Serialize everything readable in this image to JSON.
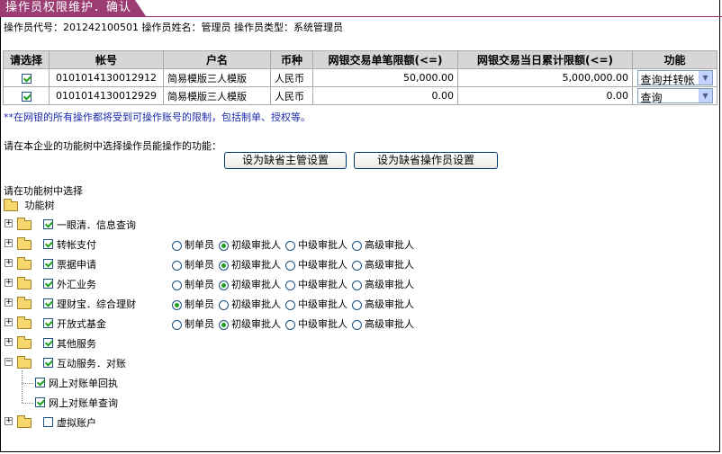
{
  "title_tab": "操作员权限维护．确认",
  "operator_info": "操作员代号：201242100501 操作员姓名：管理员 操作员类型：系统管理员",
  "table": {
    "headers": [
      "请选择",
      "帐号",
      "户名",
      "币种",
      "网银交易单笔限额(<=)",
      "网银交易当日累计限额(<=)",
      "功能"
    ],
    "rows": [
      {
        "checked": true,
        "account": "0101014130012912",
        "name": "简易模版三人模版",
        "currency": "人民币",
        "single_limit": "50,000.00",
        "daily_limit": "5,000,000.00",
        "function": "查询并转帐"
      },
      {
        "checked": true,
        "account": "0101014130012929",
        "name": "简易模版三人模版",
        "currency": "人民币",
        "single_limit": "0.00",
        "daily_limit": "0.00",
        "function": "查询"
      }
    ]
  },
  "note": "**在网银的所有操作都将受到可操作账号的限制，包括制单、授权等。",
  "prompt_function_tree": "请在本企业的功能树中选择操作员能操作的功能：",
  "buttons": {
    "default_manager": "设为缺省主管设置",
    "default_operator": "设为缺省操作员设置"
  },
  "prompt_select": "请在功能树中选择",
  "tree_root_label": "功能树",
  "role_labels": [
    "制单员",
    "初级审批人",
    "中级审批人",
    "高级审批人"
  ],
  "tree_items": [
    {
      "label": "一眼清．信息查询",
      "checked": true,
      "selected_role": null
    },
    {
      "label": "转帐支付",
      "checked": true,
      "selected_role": 1
    },
    {
      "label": "票据申请",
      "checked": true,
      "selected_role": 1
    },
    {
      "label": "外汇业务",
      "checked": true,
      "selected_role": 1
    },
    {
      "label": "理财宝．综合理财",
      "checked": true,
      "selected_role": 0
    },
    {
      "label": "开放式基金",
      "checked": true,
      "selected_role": 1
    },
    {
      "label": "其他服务",
      "checked": true,
      "selected_role": null
    },
    {
      "label": "互动服务．对账",
      "checked": true,
      "selected_role": null,
      "expanded": true,
      "children": [
        {
          "label": "网上对账单回执",
          "checked": true
        },
        {
          "label": "网上对账单查询",
          "checked": true
        }
      ]
    },
    {
      "label": "虚拟账户",
      "checked": false,
      "selected_role": null
    }
  ]
}
